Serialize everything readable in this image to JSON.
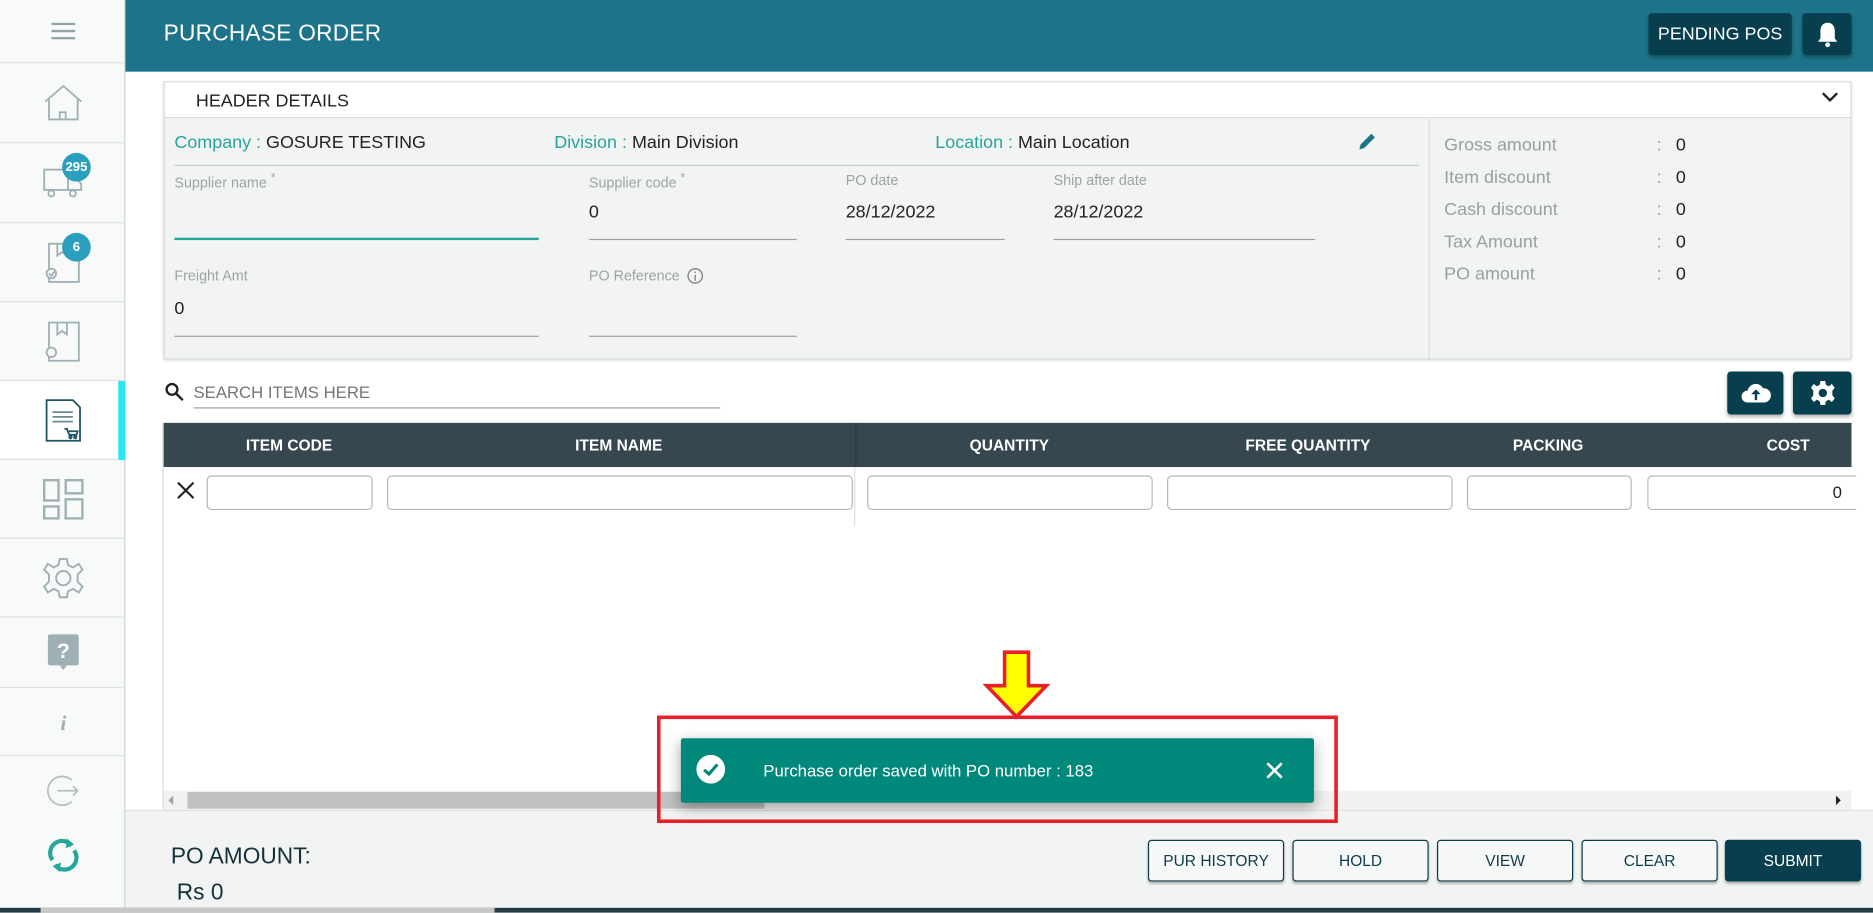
{
  "header": {
    "title": "PURCHASE ORDER",
    "pending_label": "PENDING POS"
  },
  "sidebar": {
    "items": [
      {
        "name": "home",
        "icon": "home-icon"
      },
      {
        "name": "delivery",
        "icon": "truck-icon",
        "badge": "295"
      },
      {
        "name": "received",
        "icon": "box-check-icon",
        "badge": "6"
      },
      {
        "name": "returns",
        "icon": "box-return-icon"
      },
      {
        "name": "purchase-order",
        "icon": "document-cart-icon",
        "active": true
      },
      {
        "name": "dashboard",
        "icon": "grid-icon"
      },
      {
        "name": "settings",
        "icon": "gear-icon"
      },
      {
        "name": "help",
        "icon": "help-icon"
      },
      {
        "name": "info",
        "icon": "info-icon"
      },
      {
        "name": "logout",
        "icon": "logout-icon"
      },
      {
        "name": "sync",
        "icon": "sync-icon"
      }
    ]
  },
  "details": {
    "section_title": "HEADER DETAILS",
    "company_label": "Company :",
    "company": "GOSURE TESTING",
    "division_label": "Division :",
    "division": "Main Division",
    "location_label": "Location :",
    "location": "Main Location",
    "supplier_name_label": "Supplier name",
    "supplier_name": "",
    "supplier_code_label": "Supplier code",
    "supplier_code": "0",
    "po_date_label": "PO date",
    "po_date": "28/12/2022",
    "ship_after_label": "Ship after date",
    "ship_after": "28/12/2022",
    "freight_label": "Freight Amt",
    "freight": "0",
    "po_ref_label": "PO Reference",
    "po_ref": "",
    "required_mark": "*"
  },
  "summary": [
    {
      "label": "Gross amount",
      "value": "0"
    },
    {
      "label": "Item discount",
      "value": "0"
    },
    {
      "label": "Cash discount",
      "value": "0"
    },
    {
      "label": "Tax Amount",
      "value": "0"
    },
    {
      "label": "PO amount",
      "value": "0"
    }
  ],
  "summary_colon": ":",
  "search": {
    "placeholder": "SEARCH ITEMS HERE"
  },
  "table": {
    "columns": [
      "ITEM CODE",
      "ITEM NAME",
      "QUANTITY",
      "FREE QUANTITY",
      "PACKING",
      "COST"
    ],
    "row": {
      "item_code": "",
      "item_name": "",
      "quantity": "",
      "free_quantity": "",
      "packing": "",
      "cost": "0"
    }
  },
  "footer": {
    "amount_label": "PO AMOUNT:",
    "amount": "Rs 0",
    "buttons": [
      "PUR HISTORY",
      "HOLD",
      "VIEW",
      "CLEAR",
      "SUBMIT"
    ]
  },
  "toast": {
    "message": "Purchase order saved with PO number : 183",
    "po_number": "183"
  },
  "colors": {
    "primary": "#1d7389",
    "dark": "#083f4f",
    "accent": "#26a69a",
    "toast": "#00897b",
    "annotation": "#e8202a",
    "arrow": "#ffff00"
  }
}
